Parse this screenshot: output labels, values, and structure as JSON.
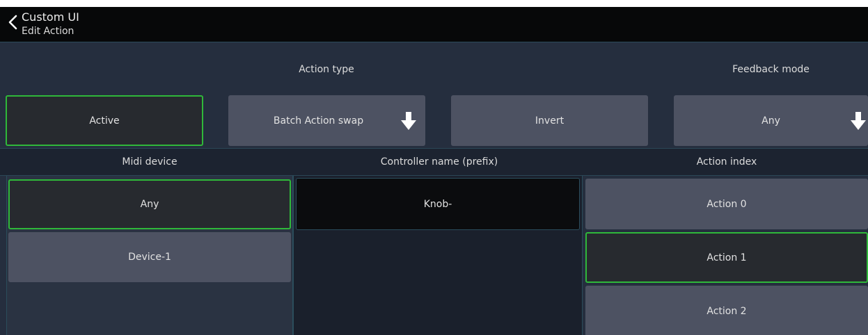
{
  "header": {
    "title": "Custom UI",
    "subtitle": "Edit Action",
    "back_icon": "chevron-left-icon"
  },
  "top_labels": {
    "action_type": "Action type",
    "feedback_mode": "Feedback mode"
  },
  "top_buttons": {
    "active": "Active",
    "action_type_value": "Batch Action swap",
    "invert": "Invert",
    "feedback_mode_value": "Any",
    "dropdown_icon": "arrow-down-icon"
  },
  "columns": {
    "midi_device": "Midi device",
    "controller_name": "Controller name (prefix)",
    "action_index": "Action index"
  },
  "midi_devices": [
    "Any",
    "Device-1"
  ],
  "controller_prefix": "Knob-",
  "action_indices": [
    "Action 0",
    "Action 1",
    "Action 2"
  ],
  "colors": {
    "accent": "#2fb83a",
    "background": "#252e3e",
    "header": "#070809",
    "button": "#4d5262",
    "button_selected": "#272a2f"
  }
}
